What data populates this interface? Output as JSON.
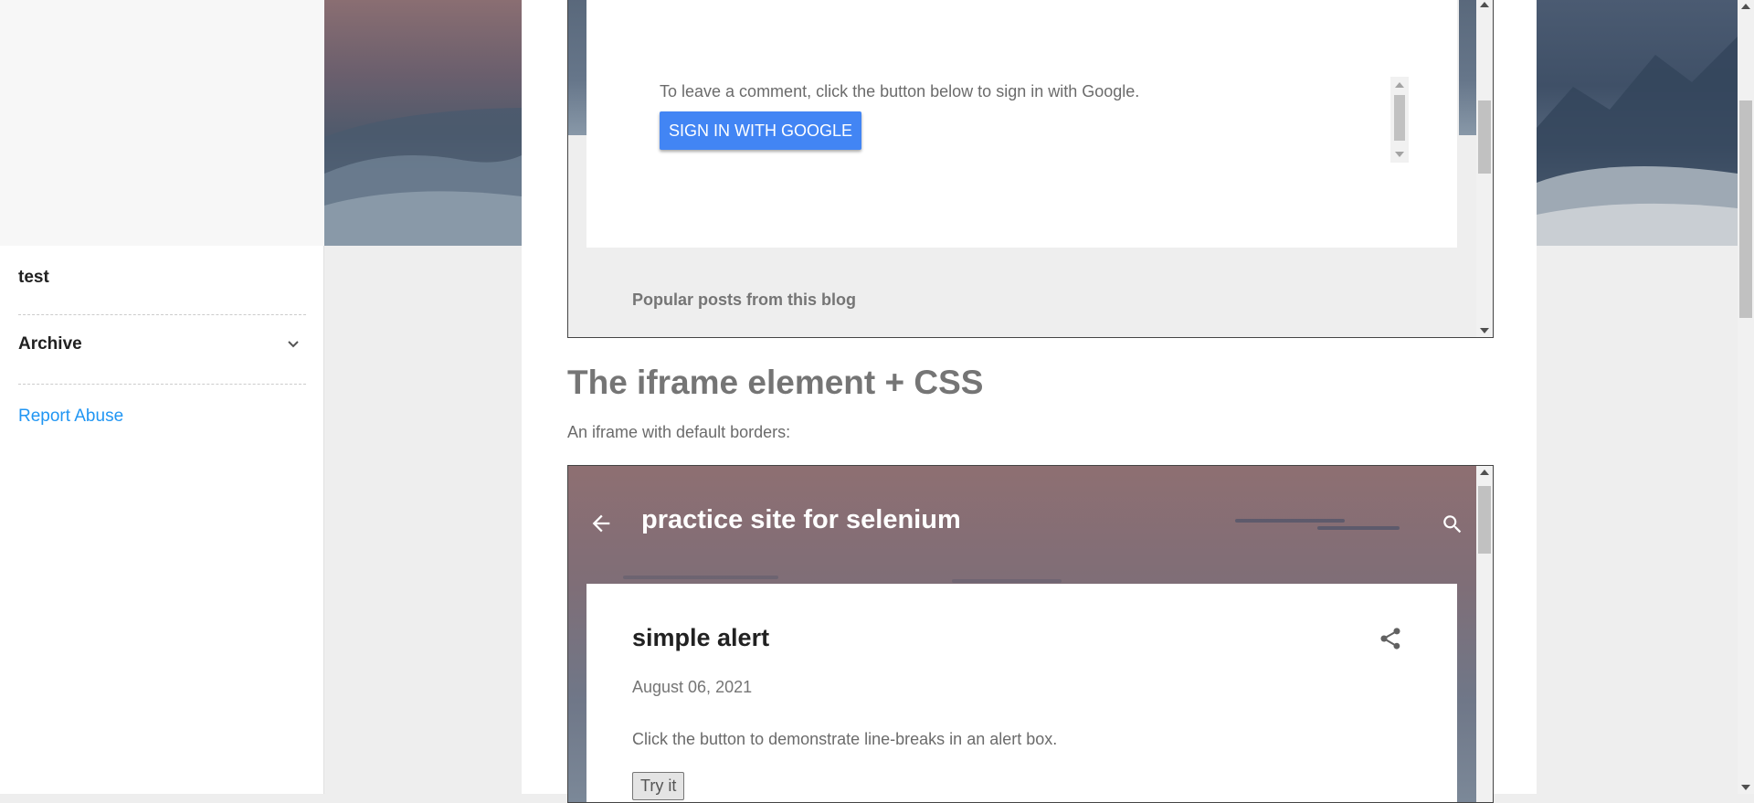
{
  "sidebar": {
    "title": "test",
    "archive_label": "Archive",
    "report_abuse_label": "Report Abuse"
  },
  "iframe_top": {
    "comment_note": "To leave a comment, click the button below to sign in with Google.",
    "sign_in_label": "SIGN IN WITH GOOGLE",
    "popular_posts_label": "Popular posts from this blog"
  },
  "main": {
    "heading": "The iframe element + CSS",
    "description": "An iframe with default borders:"
  },
  "iframe_bottom": {
    "site_title": "practice site for selenium",
    "post": {
      "title": "simple alert",
      "date": "August 06, 2021",
      "body": "Click the button to demonstrate line-breaks in an alert box.",
      "button_label": "Try it"
    }
  },
  "colors": {
    "accent_blue": "#4285f4",
    "link_blue": "#2196f3",
    "heading_gray": "#757575",
    "text_dark": "#212121"
  },
  "icons": {
    "archive_toggle": "chevron-down-icon",
    "back": "arrow-left-icon",
    "search": "search-icon",
    "share": "share-icon"
  }
}
